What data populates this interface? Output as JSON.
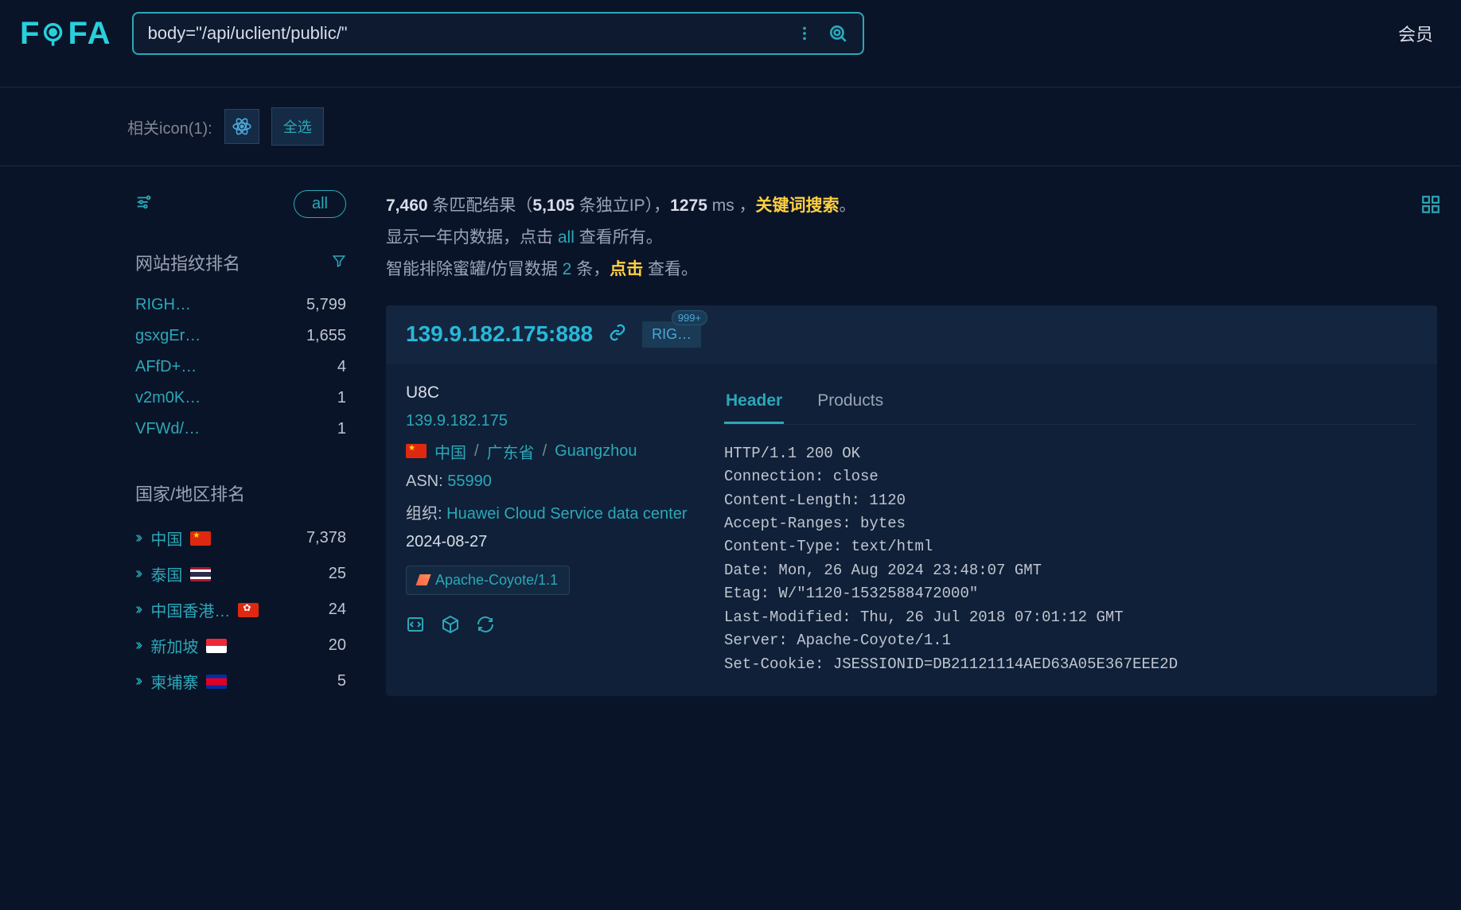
{
  "header": {
    "logo": "FOFA",
    "search_value": "body=\"/api/uclient/public/\"",
    "member_link": "会员"
  },
  "icon_bar": {
    "label": "相关icon(1):",
    "select_all": "全选"
  },
  "sidebar": {
    "all_label": "all",
    "fingerprint": {
      "title": "网站指纹排名",
      "items": [
        {
          "name": "RIGH…",
          "count": "5,799"
        },
        {
          "name": "gsxgEr…",
          "count": "1,655"
        },
        {
          "name": "AFfD+…",
          "count": "4"
        },
        {
          "name": "v2m0K…",
          "count": "1"
        },
        {
          "name": "VFWd/…",
          "count": "1"
        }
      ]
    },
    "country": {
      "title": "国家/地区排名",
      "items": [
        {
          "name": "中国",
          "flag": "flag-cn",
          "count": "7,378"
        },
        {
          "name": "泰国",
          "flag": "flag-th",
          "count": "25"
        },
        {
          "name": "中国香港…",
          "flag": "flag-hk",
          "count": "24"
        },
        {
          "name": "新加坡",
          "flag": "flag-sg",
          "count": "20"
        },
        {
          "name": "柬埔寨",
          "flag": "flag-kh",
          "count": "5"
        }
      ]
    }
  },
  "summary": {
    "total": "7,460",
    "match_text": "条匹配结果（",
    "unique": "5,105",
    "unique_text": " 条独立IP），",
    "ms": "1275",
    "ms_text": " ms ，",
    "keyword": "关键词搜索",
    "period_prefix": "显示一年内数据，点击 ",
    "all_link": "all",
    "period_suffix": " 查看所有。",
    "honeypot_prefix": "智能排除蜜罐/仿冒数据 ",
    "honeypot_count": "2",
    "honeypot_mid": " 条，",
    "click": "点击",
    "view": " 查看。"
  },
  "result": {
    "ip_port": "139.9.182.175:888",
    "tag": "RIG…",
    "tag_count": "999+",
    "title": "U8C",
    "ip": "139.9.182.175",
    "location": {
      "country": "中国",
      "region": "广东省",
      "city": "Guangzhou"
    },
    "asn_label": "ASN:",
    "asn": "55990",
    "org_label": "组织:",
    "org": "Huawei Cloud Service data center",
    "date": "2024-08-27",
    "tech": "Apache-Coyote/1.1",
    "tabs": {
      "header": "Header",
      "products": "Products"
    },
    "headers": "HTTP/1.1 200 OK\nConnection: close\nContent-Length: 1120\nAccept-Ranges: bytes\nContent-Type: text/html\nDate: Mon, 26 Aug 2024 23:48:07 GMT\nEtag: W/\"1120-1532588472000\"\nLast-Modified: Thu, 26 Jul 2018 07:01:12 GMT\nServer: Apache-Coyote/1.1\nSet-Cookie: JSESSIONID=DB21121114AED63A05E367EEE2D"
  }
}
